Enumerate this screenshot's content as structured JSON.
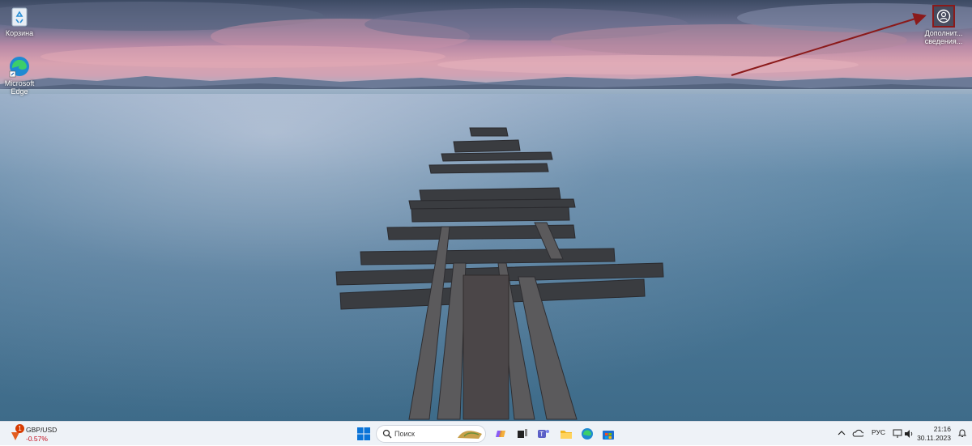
{
  "desktop": {
    "icons": [
      {
        "label": "Корзина"
      },
      {
        "label": "Microsoft Edge"
      },
      {
        "label": "Дополнит... сведения..."
      }
    ]
  },
  "taskbar": {
    "widget": {
      "badge": "1",
      "pair": "GBP/USD",
      "change": "-0.57%"
    },
    "search": {
      "placeholder": "Поиск"
    },
    "tray": {
      "language": "РУС",
      "time": "21:16",
      "date": "30.11.2023"
    }
  },
  "colors": {
    "highlight_frame": "#8b1a1a",
    "arrow": "#8b1a1a",
    "change_negative": "#c50f1f",
    "badge": "#d83b01"
  }
}
